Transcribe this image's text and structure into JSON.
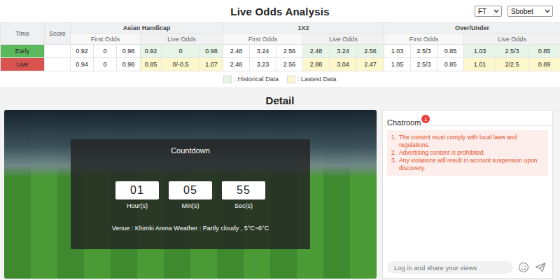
{
  "header": {
    "title": "Live Odds Analysis",
    "selects": [
      {
        "value": "FT"
      },
      {
        "value": "Sbobet"
      }
    ]
  },
  "table": {
    "columns": {
      "time": "Time",
      "score": "Score"
    },
    "groups": [
      {
        "name": "Asian Handicap",
        "first_label": "First Odds",
        "live_label": "Live Odds"
      },
      {
        "name": "1X2",
        "first_label": "First Odds",
        "live_label": "Live Odds"
      },
      {
        "name": "Over/Under",
        "first_label": "First Odds",
        "live_label": "Live Odds"
      }
    ],
    "rows": [
      {
        "label": "Early",
        "color": "#5cb85c",
        "kind": "historical",
        "odds": [
          {
            "first": [
              "0.92",
              "0",
              "0.98"
            ],
            "live": [
              "0.92",
              "0",
              "0.98"
            ]
          },
          {
            "first": [
              "2.48",
              "3.24",
              "2.56"
            ],
            "live": [
              "2.48",
              "3.24",
              "2.56"
            ]
          },
          {
            "first": [
              "1.03",
              "2.5/3",
              "0.85"
            ],
            "live": [
              "1.03",
              "2.5/3",
              "0.85"
            ]
          }
        ]
      },
      {
        "label": "Live",
        "color": "#d9534f",
        "kind": "latest",
        "odds": [
          {
            "first": [
              "0.94",
              "0",
              "0.98"
            ],
            "live": [
              "0.85",
              "0/-0.5",
              "1.07"
            ]
          },
          {
            "first": [
              "2.48",
              "3.23",
              "2.56"
            ],
            "live": [
              "2.88",
              "3.04",
              "2.47"
            ]
          },
          {
            "first": [
              "1.05",
              "2.5/3",
              "0.85"
            ],
            "live": [
              "1.01",
              "2/2.5",
              "0.89"
            ]
          }
        ]
      }
    ]
  },
  "legend": [
    {
      "label": ": Historical Data",
      "kind": "historical",
      "color": "#e6f5e8"
    },
    {
      "label": ": Lastest Data",
      "kind": "latest",
      "color": "#fdf8cc"
    }
  ],
  "detail": {
    "title": "Detail",
    "countdown": {
      "title": "Countdown",
      "units": [
        {
          "value": "01",
          "label": "Hour(s)"
        },
        {
          "value": "05",
          "label": "Min(s)"
        },
        {
          "value": "55",
          "label": "Sec(s)"
        }
      ]
    },
    "venue": "Venue : Khimki Arena Weather : Partly cloudy , 5°C~6°C"
  },
  "chat": {
    "title": "Chatroom",
    "badge": "1",
    "rules": [
      {
        "num": "1.",
        "text": "The content must comply with local laws and regulations."
      },
      {
        "num": "2.",
        "text": "Advertising content is prohibited."
      },
      {
        "num": "3.",
        "text": "Any violations will result in account suspension upon discovery."
      }
    ],
    "placeholder": "Log in and share your views"
  }
}
